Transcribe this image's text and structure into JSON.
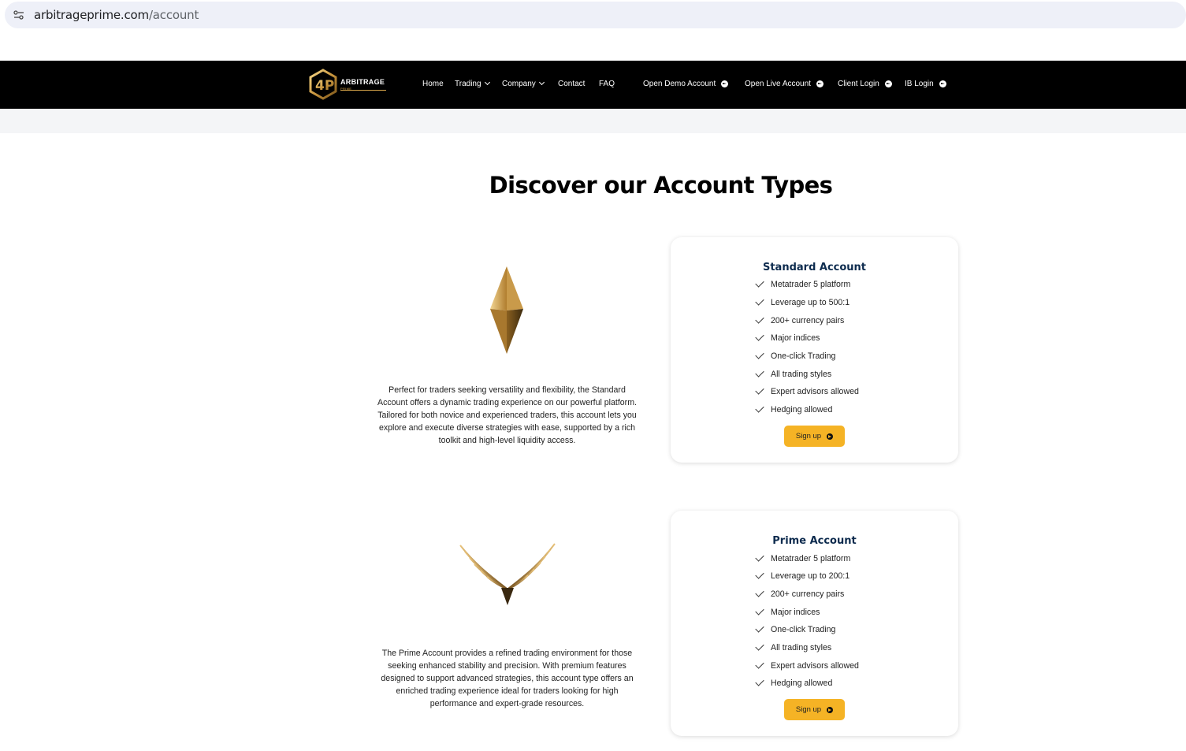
{
  "browser": {
    "url_domain": "arbitrageprime.com",
    "url_path": "/account"
  },
  "nav": {
    "logo_text": "ARBITRAGE",
    "logo_sub": "PRIME",
    "links": [
      "Home",
      "Trading",
      "Company",
      "Contact",
      "FAQ"
    ],
    "ctas": [
      "Open Demo Account",
      "Open Live Account",
      "Client Login",
      "IB Login"
    ]
  },
  "page": {
    "title": "Discover our Account Types"
  },
  "accounts": [
    {
      "name": "Standard Account",
      "description": "Perfect for traders seeking versatility and flexibility, the Standard Account offers a dynamic trading experience on our powerful platform. Tailored for both novice and experienced traders, this account lets you explore and execute diverse strategies with ease, supported by a rich toolkit and high-level liquidity access.",
      "features": [
        "Metatrader 5 platform",
        "Leverage up to 500:1",
        "200+ currency pairs",
        "Major indices",
        "One-click Trading",
        "All trading styles",
        "Expert advisors allowed",
        "Hedging allowed"
      ],
      "button": "Sign up",
      "icon": "gold-diamond-icon"
    },
    {
      "name": "Prime Account",
      "description": "The Prime Account provides a refined trading environment for those seeking enhanced stability and precision. With premium features designed to support advanced strategies, this account type offers an enriched trading experience ideal for traders looking for high performance and expert-grade resources.",
      "features": [
        "Metatrader 5 platform",
        "Leverage up to 200:1",
        "200+ currency pairs",
        "Major indices",
        "One-click Trading",
        "All trading styles",
        "Expert advisors allowed",
        "Hedging allowed"
      ],
      "button": "Sign up",
      "icon": "gold-wings-icon"
    }
  ],
  "colors": {
    "nav_bg": "#000000",
    "accent": "#f5b325",
    "title_blue": "#0d2b4e",
    "gold": "#c9963f"
  }
}
